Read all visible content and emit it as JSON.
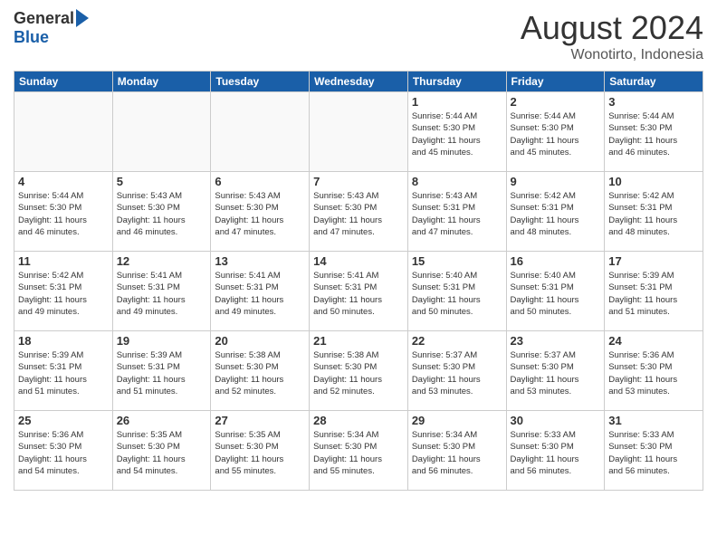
{
  "header": {
    "logo_general": "General",
    "logo_blue": "Blue",
    "month_title": "August 2024",
    "location": "Wonotirto, Indonesia"
  },
  "weekdays": [
    "Sunday",
    "Monday",
    "Tuesday",
    "Wednesday",
    "Thursday",
    "Friday",
    "Saturday"
  ],
  "weeks": [
    [
      {
        "day": "",
        "info": ""
      },
      {
        "day": "",
        "info": ""
      },
      {
        "day": "",
        "info": ""
      },
      {
        "day": "",
        "info": ""
      },
      {
        "day": "1",
        "info": "Sunrise: 5:44 AM\nSunset: 5:30 PM\nDaylight: 11 hours\nand 45 minutes."
      },
      {
        "day": "2",
        "info": "Sunrise: 5:44 AM\nSunset: 5:30 PM\nDaylight: 11 hours\nand 45 minutes."
      },
      {
        "day": "3",
        "info": "Sunrise: 5:44 AM\nSunset: 5:30 PM\nDaylight: 11 hours\nand 46 minutes."
      }
    ],
    [
      {
        "day": "4",
        "info": "Sunrise: 5:44 AM\nSunset: 5:30 PM\nDaylight: 11 hours\nand 46 minutes."
      },
      {
        "day": "5",
        "info": "Sunrise: 5:43 AM\nSunset: 5:30 PM\nDaylight: 11 hours\nand 46 minutes."
      },
      {
        "day": "6",
        "info": "Sunrise: 5:43 AM\nSunset: 5:30 PM\nDaylight: 11 hours\nand 47 minutes."
      },
      {
        "day": "7",
        "info": "Sunrise: 5:43 AM\nSunset: 5:30 PM\nDaylight: 11 hours\nand 47 minutes."
      },
      {
        "day": "8",
        "info": "Sunrise: 5:43 AM\nSunset: 5:31 PM\nDaylight: 11 hours\nand 47 minutes."
      },
      {
        "day": "9",
        "info": "Sunrise: 5:42 AM\nSunset: 5:31 PM\nDaylight: 11 hours\nand 48 minutes."
      },
      {
        "day": "10",
        "info": "Sunrise: 5:42 AM\nSunset: 5:31 PM\nDaylight: 11 hours\nand 48 minutes."
      }
    ],
    [
      {
        "day": "11",
        "info": "Sunrise: 5:42 AM\nSunset: 5:31 PM\nDaylight: 11 hours\nand 49 minutes."
      },
      {
        "day": "12",
        "info": "Sunrise: 5:41 AM\nSunset: 5:31 PM\nDaylight: 11 hours\nand 49 minutes."
      },
      {
        "day": "13",
        "info": "Sunrise: 5:41 AM\nSunset: 5:31 PM\nDaylight: 11 hours\nand 49 minutes."
      },
      {
        "day": "14",
        "info": "Sunrise: 5:41 AM\nSunset: 5:31 PM\nDaylight: 11 hours\nand 50 minutes."
      },
      {
        "day": "15",
        "info": "Sunrise: 5:40 AM\nSunset: 5:31 PM\nDaylight: 11 hours\nand 50 minutes."
      },
      {
        "day": "16",
        "info": "Sunrise: 5:40 AM\nSunset: 5:31 PM\nDaylight: 11 hours\nand 50 minutes."
      },
      {
        "day": "17",
        "info": "Sunrise: 5:39 AM\nSunset: 5:31 PM\nDaylight: 11 hours\nand 51 minutes."
      }
    ],
    [
      {
        "day": "18",
        "info": "Sunrise: 5:39 AM\nSunset: 5:31 PM\nDaylight: 11 hours\nand 51 minutes."
      },
      {
        "day": "19",
        "info": "Sunrise: 5:39 AM\nSunset: 5:31 PM\nDaylight: 11 hours\nand 51 minutes."
      },
      {
        "day": "20",
        "info": "Sunrise: 5:38 AM\nSunset: 5:30 PM\nDaylight: 11 hours\nand 52 minutes."
      },
      {
        "day": "21",
        "info": "Sunrise: 5:38 AM\nSunset: 5:30 PM\nDaylight: 11 hours\nand 52 minutes."
      },
      {
        "day": "22",
        "info": "Sunrise: 5:37 AM\nSunset: 5:30 PM\nDaylight: 11 hours\nand 53 minutes."
      },
      {
        "day": "23",
        "info": "Sunrise: 5:37 AM\nSunset: 5:30 PM\nDaylight: 11 hours\nand 53 minutes."
      },
      {
        "day": "24",
        "info": "Sunrise: 5:36 AM\nSunset: 5:30 PM\nDaylight: 11 hours\nand 53 minutes."
      }
    ],
    [
      {
        "day": "25",
        "info": "Sunrise: 5:36 AM\nSunset: 5:30 PM\nDaylight: 11 hours\nand 54 minutes."
      },
      {
        "day": "26",
        "info": "Sunrise: 5:35 AM\nSunset: 5:30 PM\nDaylight: 11 hours\nand 54 minutes."
      },
      {
        "day": "27",
        "info": "Sunrise: 5:35 AM\nSunset: 5:30 PM\nDaylight: 11 hours\nand 55 minutes."
      },
      {
        "day": "28",
        "info": "Sunrise: 5:34 AM\nSunset: 5:30 PM\nDaylight: 11 hours\nand 55 minutes."
      },
      {
        "day": "29",
        "info": "Sunrise: 5:34 AM\nSunset: 5:30 PM\nDaylight: 11 hours\nand 56 minutes."
      },
      {
        "day": "30",
        "info": "Sunrise: 5:33 AM\nSunset: 5:30 PM\nDaylight: 11 hours\nand 56 minutes."
      },
      {
        "day": "31",
        "info": "Sunrise: 5:33 AM\nSunset: 5:30 PM\nDaylight: 11 hours\nand 56 minutes."
      }
    ]
  ]
}
